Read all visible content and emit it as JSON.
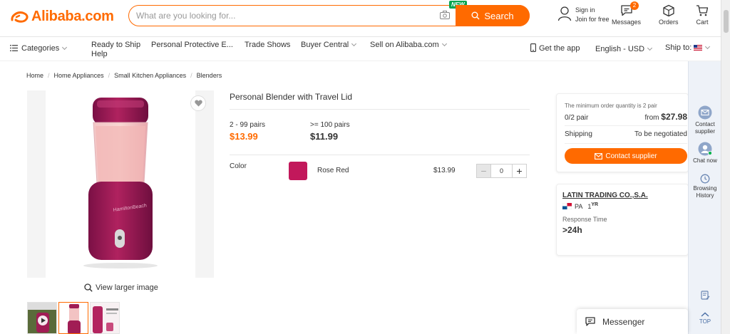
{
  "header": {
    "logo_text": "Alibaba.com",
    "search_placeholder": "What are you looking for...",
    "new_badge": "NEW",
    "search_button": "Search",
    "sign_in": "Sign in",
    "join_free": "Join for free",
    "messages_label": "Messages",
    "messages_count": "2",
    "orders_label": "Orders",
    "cart_label": "Cart"
  },
  "nav": {
    "categories": "Categories",
    "items": [
      "Ready to Ship",
      "Personal Protective E...",
      "Trade Shows",
      "Buyer Central",
      "Sell on Alibaba.com"
    ],
    "help": "Help",
    "get_app": "Get the app",
    "language": "English - USD",
    "ship_to": "Ship to:"
  },
  "breadcrumb": [
    "Home",
    "Home Appliances",
    "Small Kitchen Appliances",
    "Blenders"
  ],
  "gallery": {
    "view_larger": "View larger image"
  },
  "product": {
    "title": "Personal Blender with Travel Lid",
    "tiers": [
      {
        "range": "2 - 99 pairs",
        "price": "$13.99"
      },
      {
        "range": ">= 100 pairs",
        "price": "$11.99"
      }
    ],
    "color_label": "Color",
    "color_name": "Rose Red",
    "color_price": "$13.99",
    "quantity": "0"
  },
  "order": {
    "min_note": "The minimum order quantity is 2 pair",
    "progress": "0/2 pair",
    "from_label": "from",
    "from_price": "$27.98",
    "shipping_label": "Shipping",
    "shipping_value": "To be negotiated",
    "contact_button": "Contact supplier"
  },
  "supplier": {
    "name": "LATIN TRADING CO.,S.A.",
    "country": "PA",
    "years": "1",
    "years_unit": "YR",
    "response_label": "Response Time",
    "response_value": ">24h"
  },
  "rail": {
    "contact": "Contact supplier",
    "chat": "Chat now",
    "browsing": "Browsing History",
    "top": "TOP"
  },
  "messenger": {
    "label": "Messenger"
  },
  "colors": {
    "accent": "#ff6a00",
    "swatch": "#c2185b"
  }
}
